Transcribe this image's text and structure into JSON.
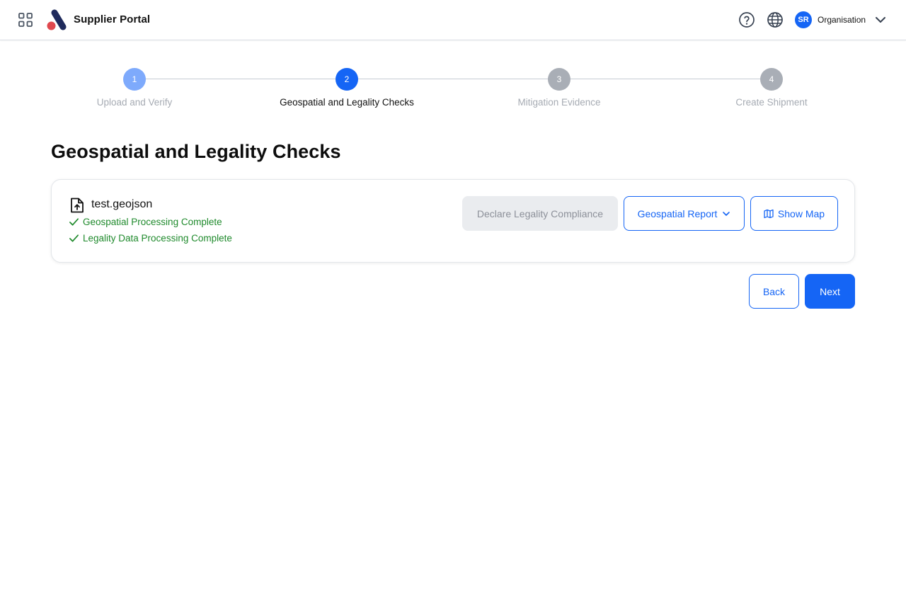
{
  "header": {
    "apps_icon": "grid-icon",
    "brand": "Supplier Portal",
    "help_icon": "help-icon",
    "language_icon": "globe-icon",
    "user_initials": "SR",
    "organisation": "Organisation"
  },
  "stepper": {
    "steps": [
      {
        "number": "1",
        "label": "Upload and Verify",
        "state": "done"
      },
      {
        "number": "2",
        "label": "Geospatial and Legality Checks",
        "state": "active"
      },
      {
        "number": "3",
        "label": "Mitigation Evidence",
        "state": "pending"
      },
      {
        "number": "4",
        "label": "Create Shipment",
        "state": "pending"
      }
    ]
  },
  "page": {
    "title": "Geospatial and Legality Checks"
  },
  "card": {
    "file_name": "test.geojson",
    "statuses": [
      "Geospatial Processing Complete",
      "Legality Data Processing Complete"
    ],
    "declare_label": "Declare Legality Compliance",
    "report_label": "Geospatial Report",
    "map_label": "Show Map"
  },
  "nav": {
    "back_label": "Back",
    "next_label": "Next"
  },
  "colors": {
    "primary": "#1565f5",
    "success": "#1f8a2c",
    "step_done": "#7eaafc",
    "step_pending": "#a9aeb6"
  }
}
